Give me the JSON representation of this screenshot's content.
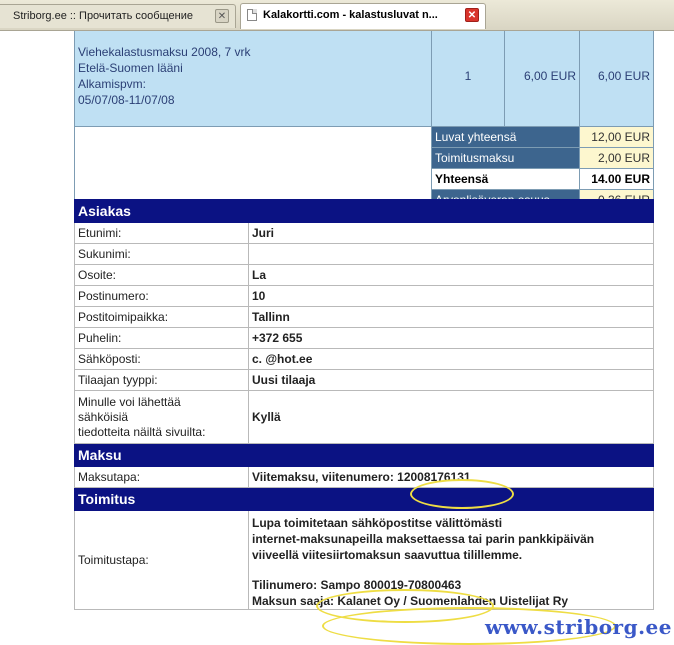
{
  "tabs": [
    {
      "label": "Striborg.ee :: Прочитать сообщение",
      "active": false
    },
    {
      "label": "Kalakortti.com - kalastusluvat n...",
      "active": true
    }
  ],
  "order": {
    "product_line1": "Viehekalastusmaksu 2008, 7 vrk",
    "product_line2": "Etelä-Suomen lääni",
    "product_line3": "Alkamispvm:",
    "product_line4": "05/07/08-11/07/08",
    "qty": "1",
    "price": "6,00 EUR",
    "total": "6,00 EUR",
    "summary": [
      {
        "label": "Luvat yhteensä",
        "value": "12,00 EUR"
      },
      {
        "label": "Toimitusmaksu",
        "value": "2,00 EUR"
      },
      {
        "label": "Yhteensä",
        "value": "14.00 EUR"
      },
      {
        "label": "Arvonlisäveron osuus",
        "value": "0,36 EUR"
      }
    ]
  },
  "customer": {
    "title": "Asiakas",
    "rows": [
      {
        "label": "Etunimi:",
        "value": "Juri"
      },
      {
        "label": "Sukunimi:",
        "value": ""
      },
      {
        "label": "Osoite:",
        "value": "La"
      },
      {
        "label": "Postinumero:",
        "value": "10"
      },
      {
        "label": "Postitoimipaikka:",
        "value": "Tallinn"
      },
      {
        "label": "Puhelin:",
        "value": "+372 655"
      },
      {
        "label": "Sähköposti:",
        "value": "c.    @hot.ee"
      },
      {
        "label": "Tilaajan tyyppi:",
        "value": "Uusi tilaaja"
      }
    ],
    "newsletter_label_1": "Minulle voi lähettää",
    "newsletter_label_2": "sähköisiä",
    "newsletter_label_3": "tiedotteita näiltä sivuilta:",
    "newsletter_value": "Kyllä"
  },
  "payment": {
    "title": "Maksu",
    "label": "Maksutapa:",
    "value": "Viitemaksu, viitenumero: 12008176131"
  },
  "delivery": {
    "title": "Toimitus",
    "label": "Toimitustapa:",
    "line1": "Lupa toimitetaan sähköpostitse välittömästi",
    "line2": "internet-maksunapeilla maksettaessa tai parin pankkipäivän",
    "line3": "viiveellä viitesiirtomaksun saavuttua tilillemme.",
    "line4": "Tilinumero: Sampo 800019-70800463",
    "line5": "Maksun saaja: Kalanet Oy / Suomenlahden Uistelijat Ry"
  },
  "watermark": "www.striborg.ee"
}
